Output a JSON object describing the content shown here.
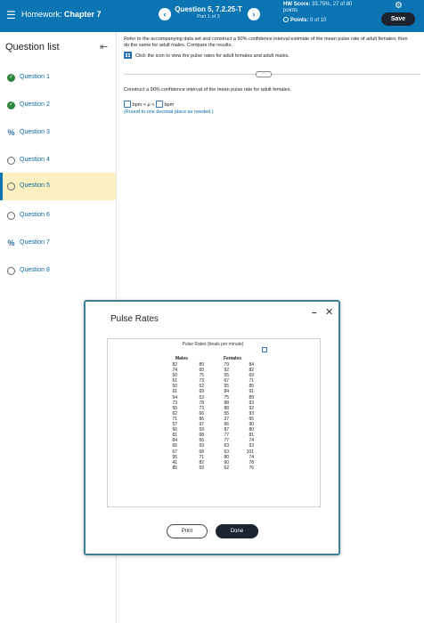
{
  "header": {
    "menu_icon": "hamburger-icon",
    "hw_prefix": "Homework:",
    "hw_name": "Chapter 7",
    "question_title": "Question 5, 7.2.25-T",
    "part": "Part 1 of 3",
    "hw_score_label": "HW Score:",
    "hw_score_value": "33.75%, 27 of 80",
    "hw_score_unit": "points",
    "points_label": "Points:",
    "points_value": "0 of 10",
    "save_label": "Save",
    "prev_glyph": "‹",
    "next_glyph": "›",
    "colors": {
      "bar": "#0b75b4",
      "save": "#1b2430"
    }
  },
  "sidebar": {
    "title": "Question list",
    "items": [
      {
        "label": "Question 1",
        "status": "done"
      },
      {
        "label": "Question 2",
        "status": "done"
      },
      {
        "label": "Question 3",
        "status": "partial"
      },
      {
        "label": "Question 4",
        "status": "empty"
      },
      {
        "label": "Question 5",
        "status": "current"
      },
      {
        "label": "Question 6",
        "status": "empty"
      },
      {
        "label": "Question 7",
        "status": "partial"
      },
      {
        "label": "Question 8",
        "status": "empty"
      }
    ]
  },
  "main": {
    "instructions": "Refer to the accompanying data set and construct a 90% confidence interval estimate of the mean pulse rate of adult females; then do the same for adult males. Compare the results.",
    "table_link": "Click the icon to view the pulse rates for adult females and adult males.",
    "construct_text": "Construct a 90% confidence interval of the mean pulse rate for adult females.",
    "unit1": "bpm < μ <",
    "unit2": "bpm",
    "round_note": "(Round to one decimal place as needed.)"
  },
  "modal": {
    "title": "Pulse Rates",
    "caption": "Pulse Rates (beats per minute)",
    "males_label": "Males",
    "females_label": "Females",
    "males_col1": [
      "82",
      "74",
      "50",
      "61",
      "50",
      "61",
      "54",
      "73",
      "55",
      "62",
      "71",
      "57",
      "66",
      "81",
      "84",
      "66",
      "67",
      "95",
      "41",
      "85"
    ],
    "males_col2": [
      "89",
      "65",
      "75",
      "73",
      "52",
      "69",
      "53",
      "78",
      "73",
      "66",
      "86",
      "97",
      "59",
      "68",
      "56",
      "59",
      "68",
      "71",
      "82",
      "59"
    ],
    "females_col1": [
      "79",
      "92",
      "55",
      "67",
      "55",
      "84",
      "75",
      "88",
      "88",
      "55",
      "37",
      "66",
      "87",
      "77",
      "77",
      "63",
      "63",
      "80",
      "60",
      "62"
    ],
    "females_col2": [
      "84",
      "82",
      "69",
      "71",
      "85",
      "91",
      "89",
      "93",
      "92",
      "93",
      "65",
      "90",
      "80",
      "81",
      "74",
      "53",
      "101",
      "74",
      "78",
      "76"
    ],
    "print_label": "Print",
    "done_label": "Done",
    "minimize_glyph": "–",
    "close_glyph": "✕"
  }
}
